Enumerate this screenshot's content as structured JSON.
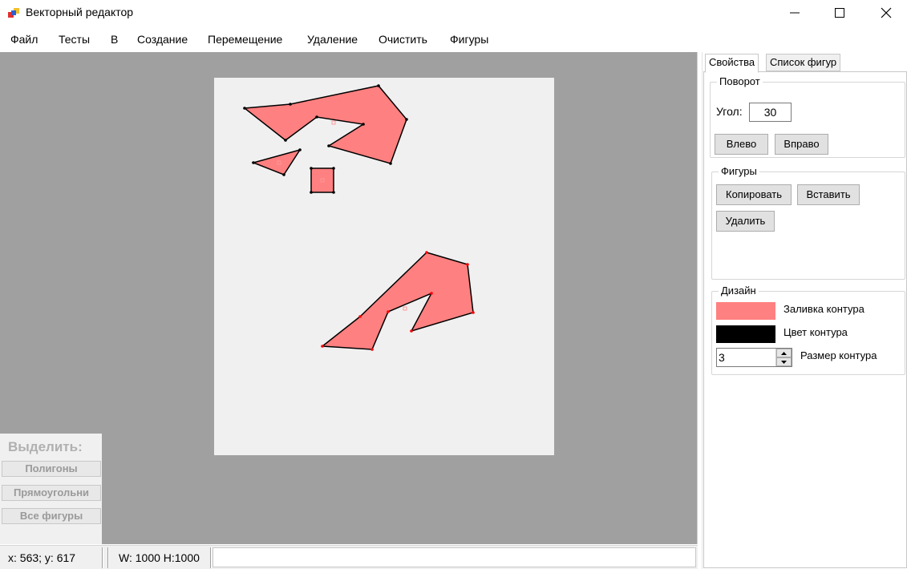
{
  "window": {
    "title": "Векторный редактор"
  },
  "menu": [
    "Файл",
    "Тесты",
    "В",
    "Создание",
    "Перемещение",
    "Удаление",
    "Очистить",
    "Фигуры"
  ],
  "select_panel": {
    "title": "Выделить:",
    "buttons": [
      "Полигоны",
      "Прямоугольни",
      "Все фигуры"
    ]
  },
  "status": {
    "cursor": "x: 563; y: 617",
    "size": "W:  1000  H:1000"
  },
  "properties": {
    "tabs": [
      "Свойства",
      "Список фигур"
    ],
    "rotation": {
      "title": "Поворот",
      "angle_label": "Угол:",
      "angle_value": "30",
      "left_button": "Влево",
      "right_button": "Вправо"
    },
    "figures": {
      "title": "Фигуры",
      "copy_button": "Копировать",
      "paste_button": "Вставить",
      "delete_button": "Удалить"
    },
    "design": {
      "title": "Дизайн",
      "fill_label": "Заливка контура",
      "stroke_label": "Цвет контура",
      "stroke_size_label": "Размер контура",
      "stroke_size_value": "3",
      "fill_color": "#ff8080",
      "stroke_color": "#000000"
    }
  },
  "colors": {
    "workspace_bg": "#a0a0a0",
    "canvas_bg": "#f0f0f0",
    "shape_fill": "#ff8080",
    "vertex_normal": "#000000",
    "vertex_selected": "#ff0000"
  },
  "icons": {
    "app": "app-icon",
    "minimize": "minimize-icon",
    "maximize": "maximize-icon",
    "close": "close-icon",
    "spin_up": "chevron-up-icon",
    "spin_down": "chevron-down-icon"
  }
}
